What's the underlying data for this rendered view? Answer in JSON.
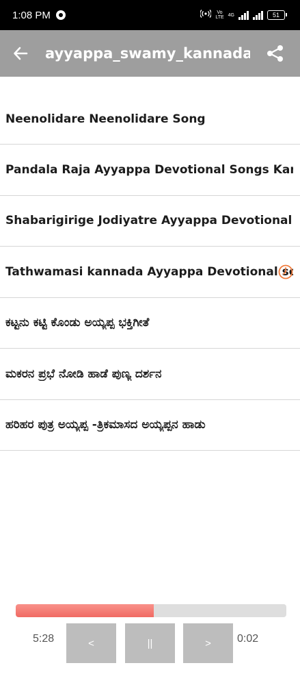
{
  "status_bar": {
    "time": "1:08 PM",
    "volte_top": "Vo",
    "volte_bottom": "LTE",
    "network": "4G",
    "battery": "51"
  },
  "app_bar": {
    "title": "ayyappa_swamy_kannada_",
    "back_icon": "arrow-left-icon",
    "share_icon": "share-icon",
    "color": "#9e9e9e"
  },
  "songs": [
    {
      "title": "Neenolidare Neenolidare Song"
    },
    {
      "title": "Pandala Raja Ayyappa Devotional Songs Kannada"
    },
    {
      "title": "Shabarigirige Jodiyatre  Ayyappa Devotional Songs"
    },
    {
      "title": "Tathwamasi kannada Ayyappa Devotional song"
    },
    {
      "title": "ಕಟ್ಟನು ಕಟ್ಟಿ ಕೊಂಡು  ಅಯ್ಯಪ್ಪ ಭಕ್ತಿಗೀತೆ"
    },
    {
      "title": "ಮಕರನ ಪ್ರಭೆ ನೋಡಿ ಹಾಡೆ ಪುಣ್ಯ ದರ್ಶನ"
    },
    {
      "title": "ಹರಿಹರ ಪುತ್ರ ಅಯ್ಯಪ್ಪ  -ತ್ರಿಕಮಾಸದ ಅಯ್ಯಪ್ಪನ ಹಾಡು"
    }
  ],
  "player": {
    "progress": 0.51,
    "progress_color": "#f06a63",
    "elapsed_time": "5:28",
    "remaining_time": "0:02",
    "prev_label": "<",
    "pause_label": "||",
    "next_label": ">"
  }
}
